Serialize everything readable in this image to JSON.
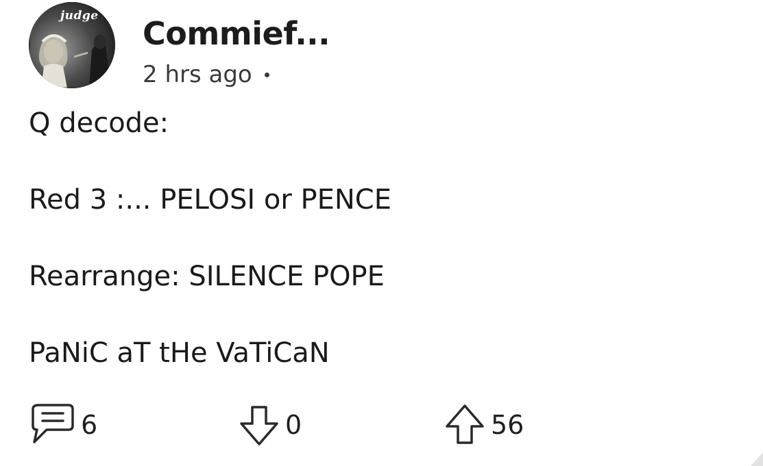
{
  "post": {
    "author": "Commief...",
    "timestamp": "2 hrs ago",
    "avatar": {
      "icon": "avatar-image",
      "badge_text": "judge"
    },
    "body_lines": [
      "Q decode:",
      "Red 3 :... PELOSI or PENCE",
      "Rearrange: SILENCE POPE",
      "PaNiC aT tHe VaTiCaN"
    ],
    "actions": {
      "comments": {
        "icon": "comment-icon",
        "count": "6"
      },
      "downvotes": {
        "icon": "arrow-down-icon",
        "count": "0"
      },
      "upvotes": {
        "icon": "arrow-up-icon",
        "count": "56"
      }
    }
  },
  "colors": {
    "background": "#ffffff",
    "text": "#1a1a1a",
    "muted": "#3a3a3a"
  }
}
